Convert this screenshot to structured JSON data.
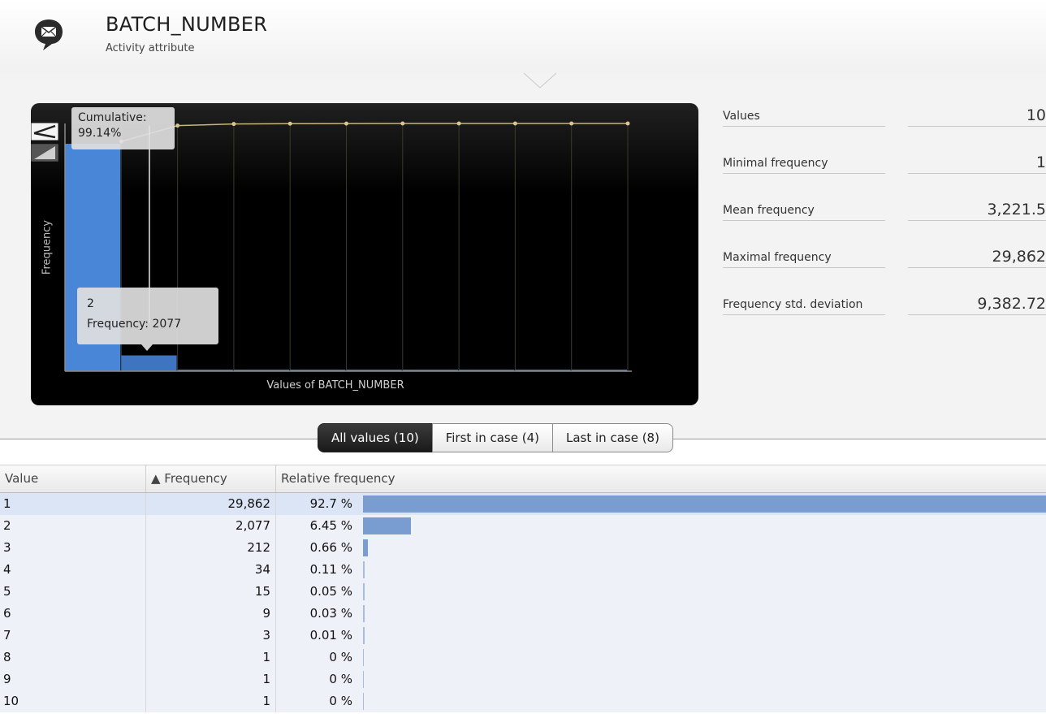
{
  "header": {
    "title": "BATCH_NUMBER",
    "subtitle": "Activity attribute",
    "icon": "message-icon"
  },
  "chart": {
    "cumulative_tooltip": {
      "label": "Cumulative:",
      "value": "99.14%"
    },
    "bar_tooltip": {
      "value": "2",
      "frequency": "Frequency: 2077"
    },
    "ylabel": "Frequency",
    "xlabel": "Values of BATCH_NUMBER",
    "mode_buttons": [
      "cumulative-curve-icon",
      "distribution-ramp-icon"
    ]
  },
  "chart_data": {
    "type": "bar",
    "categories": [
      "1",
      "2",
      "3",
      "4",
      "5",
      "6",
      "7",
      "8",
      "9",
      "10"
    ],
    "values": [
      29862,
      2077,
      212,
      34,
      15,
      9,
      3,
      1,
      1,
      1
    ],
    "cumulative_percent": [
      92.7,
      99.14,
      99.8,
      99.91,
      99.96,
      99.99,
      100,
      100,
      100,
      100
    ],
    "xlabel": "Values of BATCH_NUMBER",
    "ylabel": "Frequency",
    "colors": {
      "bar": "#3f7fd6",
      "cumulative_line": "#c9b67a"
    }
  },
  "stats": [
    {
      "label": "Values",
      "value": "10"
    },
    {
      "label": "Minimal frequency",
      "value": "1"
    },
    {
      "label": "Mean frequency",
      "value": "3,221.5"
    },
    {
      "label": "Maximal frequency",
      "value": "29,862"
    },
    {
      "label": "Frequency std. deviation",
      "value": "9,382.72"
    }
  ],
  "tabs": [
    {
      "label": "All values (10)",
      "active": true
    },
    {
      "label": "First in case (4)",
      "active": false
    },
    {
      "label": "Last in case (8)",
      "active": false
    }
  ],
  "table": {
    "headers": {
      "value": "Value",
      "frequency": "▲ Frequency",
      "relative": "Relative frequency"
    },
    "rows": [
      {
        "value": "1",
        "frequency": "29,862",
        "relative": "92.7 %",
        "share": 0.927
      },
      {
        "value": "2",
        "frequency": "2,077",
        "relative": "6.45 %",
        "share": 0.0645
      },
      {
        "value": "3",
        "frequency": "212",
        "relative": "0.66 %",
        "share": 0.0066
      },
      {
        "value": "4",
        "frequency": "34",
        "relative": "0.11 %",
        "share": 0.0011
      },
      {
        "value": "5",
        "frequency": "15",
        "relative": "0.05 %",
        "share": 0.0005
      },
      {
        "value": "6",
        "frequency": "9",
        "relative": "0.03 %",
        "share": 0.0003
      },
      {
        "value": "7",
        "frequency": "3",
        "relative": "0.01 %",
        "share": 0.0001
      },
      {
        "value": "8",
        "frequency": "1",
        "relative": "0 %",
        "share": 0
      },
      {
        "value": "9",
        "frequency": "1",
        "relative": "0 %",
        "share": 0
      },
      {
        "value": "10",
        "frequency": "1",
        "relative": "0 %",
        "share": 0
      }
    ]
  }
}
